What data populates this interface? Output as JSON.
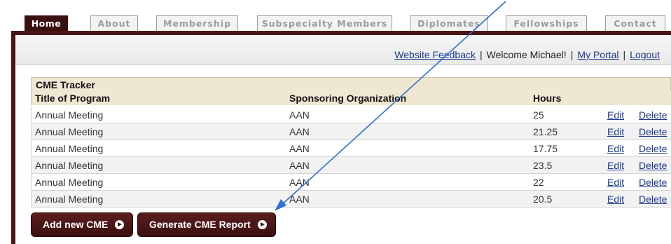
{
  "nav": {
    "tabs": [
      {
        "label": "Home",
        "active": true
      },
      {
        "label": "About"
      },
      {
        "label": "Membership"
      },
      {
        "label": "Subspecialty Members"
      },
      {
        "label": "Diplomates"
      },
      {
        "label": "Fellowships"
      },
      {
        "label": "Contact"
      }
    ]
  },
  "utility": {
    "feedback": "Website Feedback",
    "welcome": "Welcome Michael!",
    "portal": "My Portal",
    "logout": "Logout",
    "separator": "|"
  },
  "tracker": {
    "title": "CME Tracker",
    "columns": [
      "Title of Program",
      "Sponsoring Organization",
      "Hours"
    ],
    "rows": [
      {
        "program": "Annual Meeting",
        "org": "AAN",
        "hours": "25",
        "edit": "Edit",
        "delete": "Delete"
      },
      {
        "program": "Annual Meeting",
        "org": "AAN",
        "hours": "21.25",
        "edit": "Edit",
        "delete": "Delete"
      },
      {
        "program": "Annual Meeting",
        "org": "AAN",
        "hours": "17.75",
        "edit": "Edit",
        "delete": "Delete"
      },
      {
        "program": "Annual Meeting",
        "org": "AAN",
        "hours": "23.5",
        "edit": "Edit",
        "delete": "Delete"
      },
      {
        "program": "Annual Meeting",
        "org": "AAN",
        "hours": "22",
        "edit": "Edit",
        "delete": "Delete"
      },
      {
        "program": "Annual Meeting",
        "org": "AAN",
        "hours": "20.5",
        "edit": "Edit",
        "delete": "Delete"
      }
    ]
  },
  "actions": {
    "add": "Add new CME",
    "report": "Generate CME Report",
    "icon": "arrow-circle-right-icon"
  },
  "colors": {
    "brand": "#4b1515",
    "header_bg": "#f0e7d2",
    "link": "#1a3a8c",
    "annotation": "#2f6fd6"
  }
}
